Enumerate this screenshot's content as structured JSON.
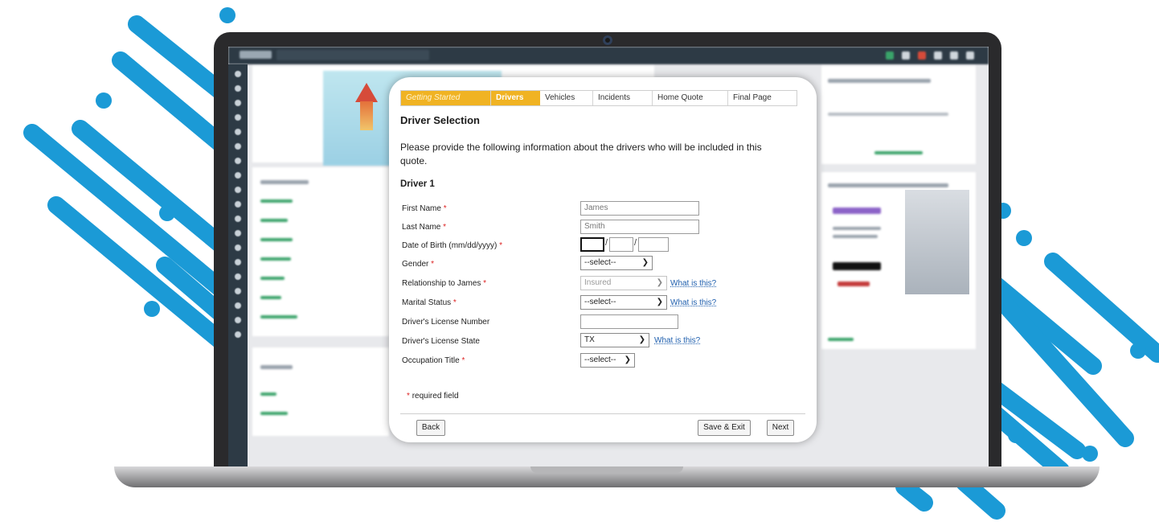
{
  "modal": {
    "tabs": [
      "Getting Started",
      "Drivers",
      "Vehicles",
      "Incidents",
      "Home Quote",
      "Final Page"
    ],
    "active_tab": "Drivers",
    "title": "Driver Selection",
    "intro": "Please provide the following information about the drivers who will be included in this quote.",
    "driver_heading": "Driver 1",
    "fields": {
      "first_name": {
        "label": "First Name",
        "value": "James"
      },
      "last_name": {
        "label": "Last Name",
        "value": "Smith"
      },
      "dob": {
        "label": "Date of Birth (mm/dd/yyyy)",
        "month": "",
        "day": "",
        "year": ""
      },
      "gender": {
        "label": "Gender",
        "value": "--select--"
      },
      "relationship": {
        "label": "Relationship to James",
        "value": "Insured",
        "help": "What is this?"
      },
      "marital": {
        "label": "Marital Status",
        "value": "--select--",
        "help": "What is this?"
      },
      "license_number": {
        "label": "Driver's License Number",
        "value": ""
      },
      "license_state": {
        "label": "Driver's License State",
        "value": "TX",
        "help": "What is this?"
      },
      "occupation": {
        "label": "Occupation Title",
        "value": "--select--"
      }
    },
    "required_marker": "*",
    "required_note": "required field",
    "buttons": {
      "back": "Back",
      "save_exit": "Save & Exit",
      "next": "Next"
    },
    "colors": {
      "tab_accent": "#f0b323",
      "link": "#1f5fae",
      "required": "#dd2222"
    }
  },
  "icons": {
    "dropdown": "chevron-down-icon",
    "camera": "webcam-icon"
  },
  "decoration": {
    "stripe_color": "#1b9ad6"
  }
}
